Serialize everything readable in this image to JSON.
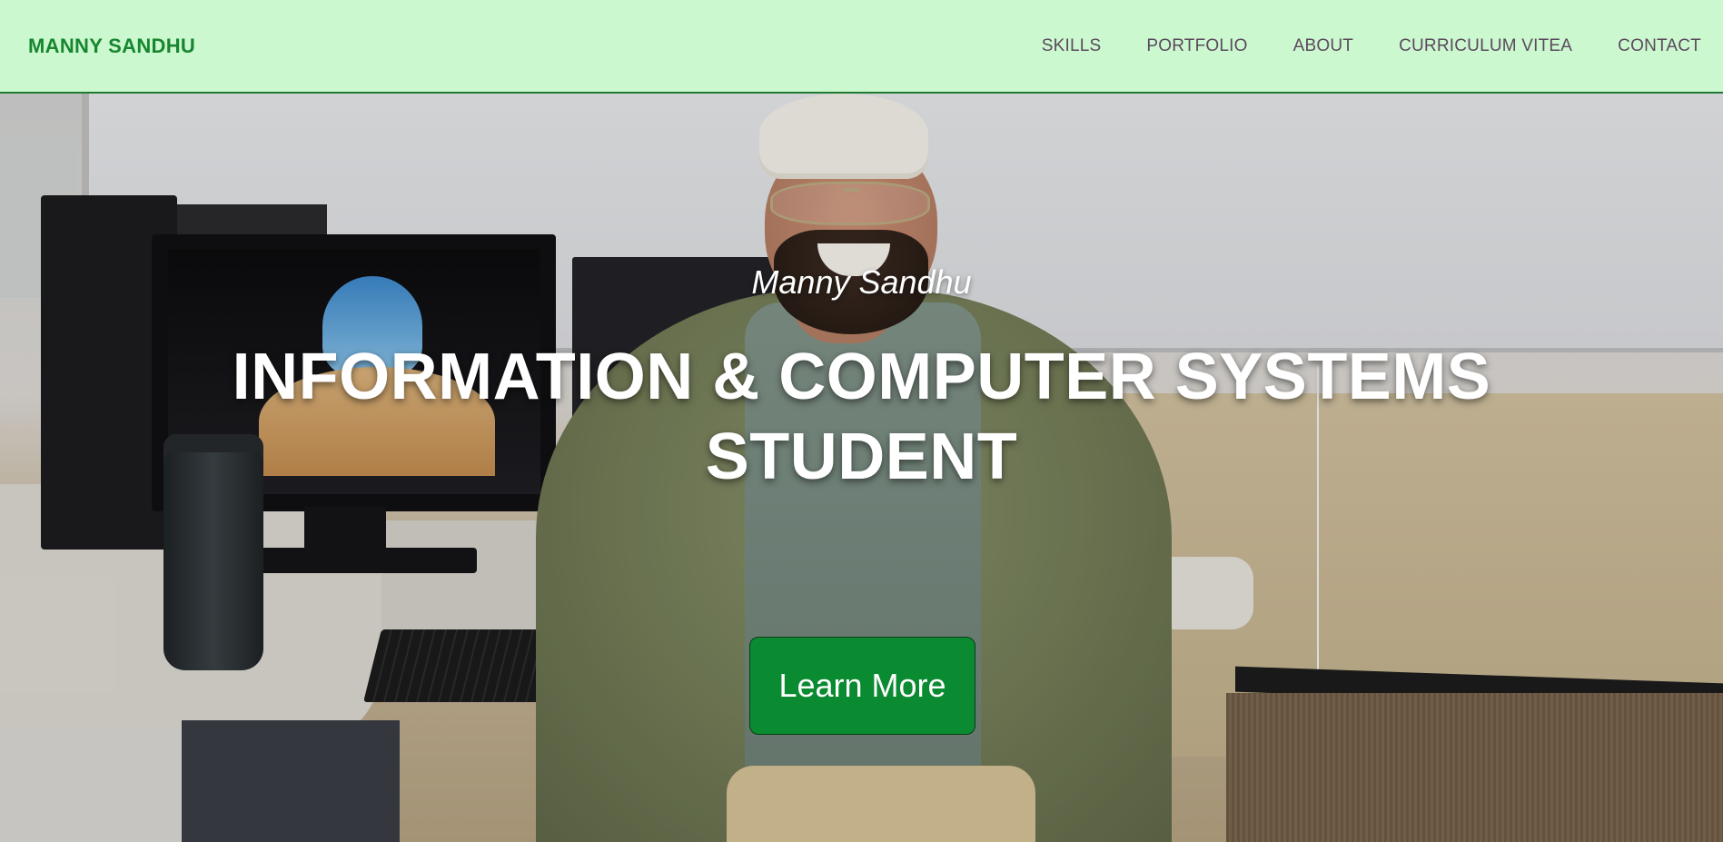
{
  "navbar": {
    "brand": "MANNY SANDHU",
    "links": [
      {
        "label": "SKILLS"
      },
      {
        "label": "PORTFOLIO"
      },
      {
        "label": "ABOUT"
      },
      {
        "label": "CURRICULUM VITEA"
      },
      {
        "label": "CONTACT"
      }
    ]
  },
  "hero": {
    "name": "Manny Sandhu",
    "title": "INFORMATION & COMPUTER SYSTEMS STUDENT",
    "cta_label": "Learn More"
  },
  "colors": {
    "navbar_bg": "#ccf8cf",
    "brand": "#17862f",
    "nav_link": "#5b4a5e",
    "cta_bg": "#0a8a31"
  }
}
